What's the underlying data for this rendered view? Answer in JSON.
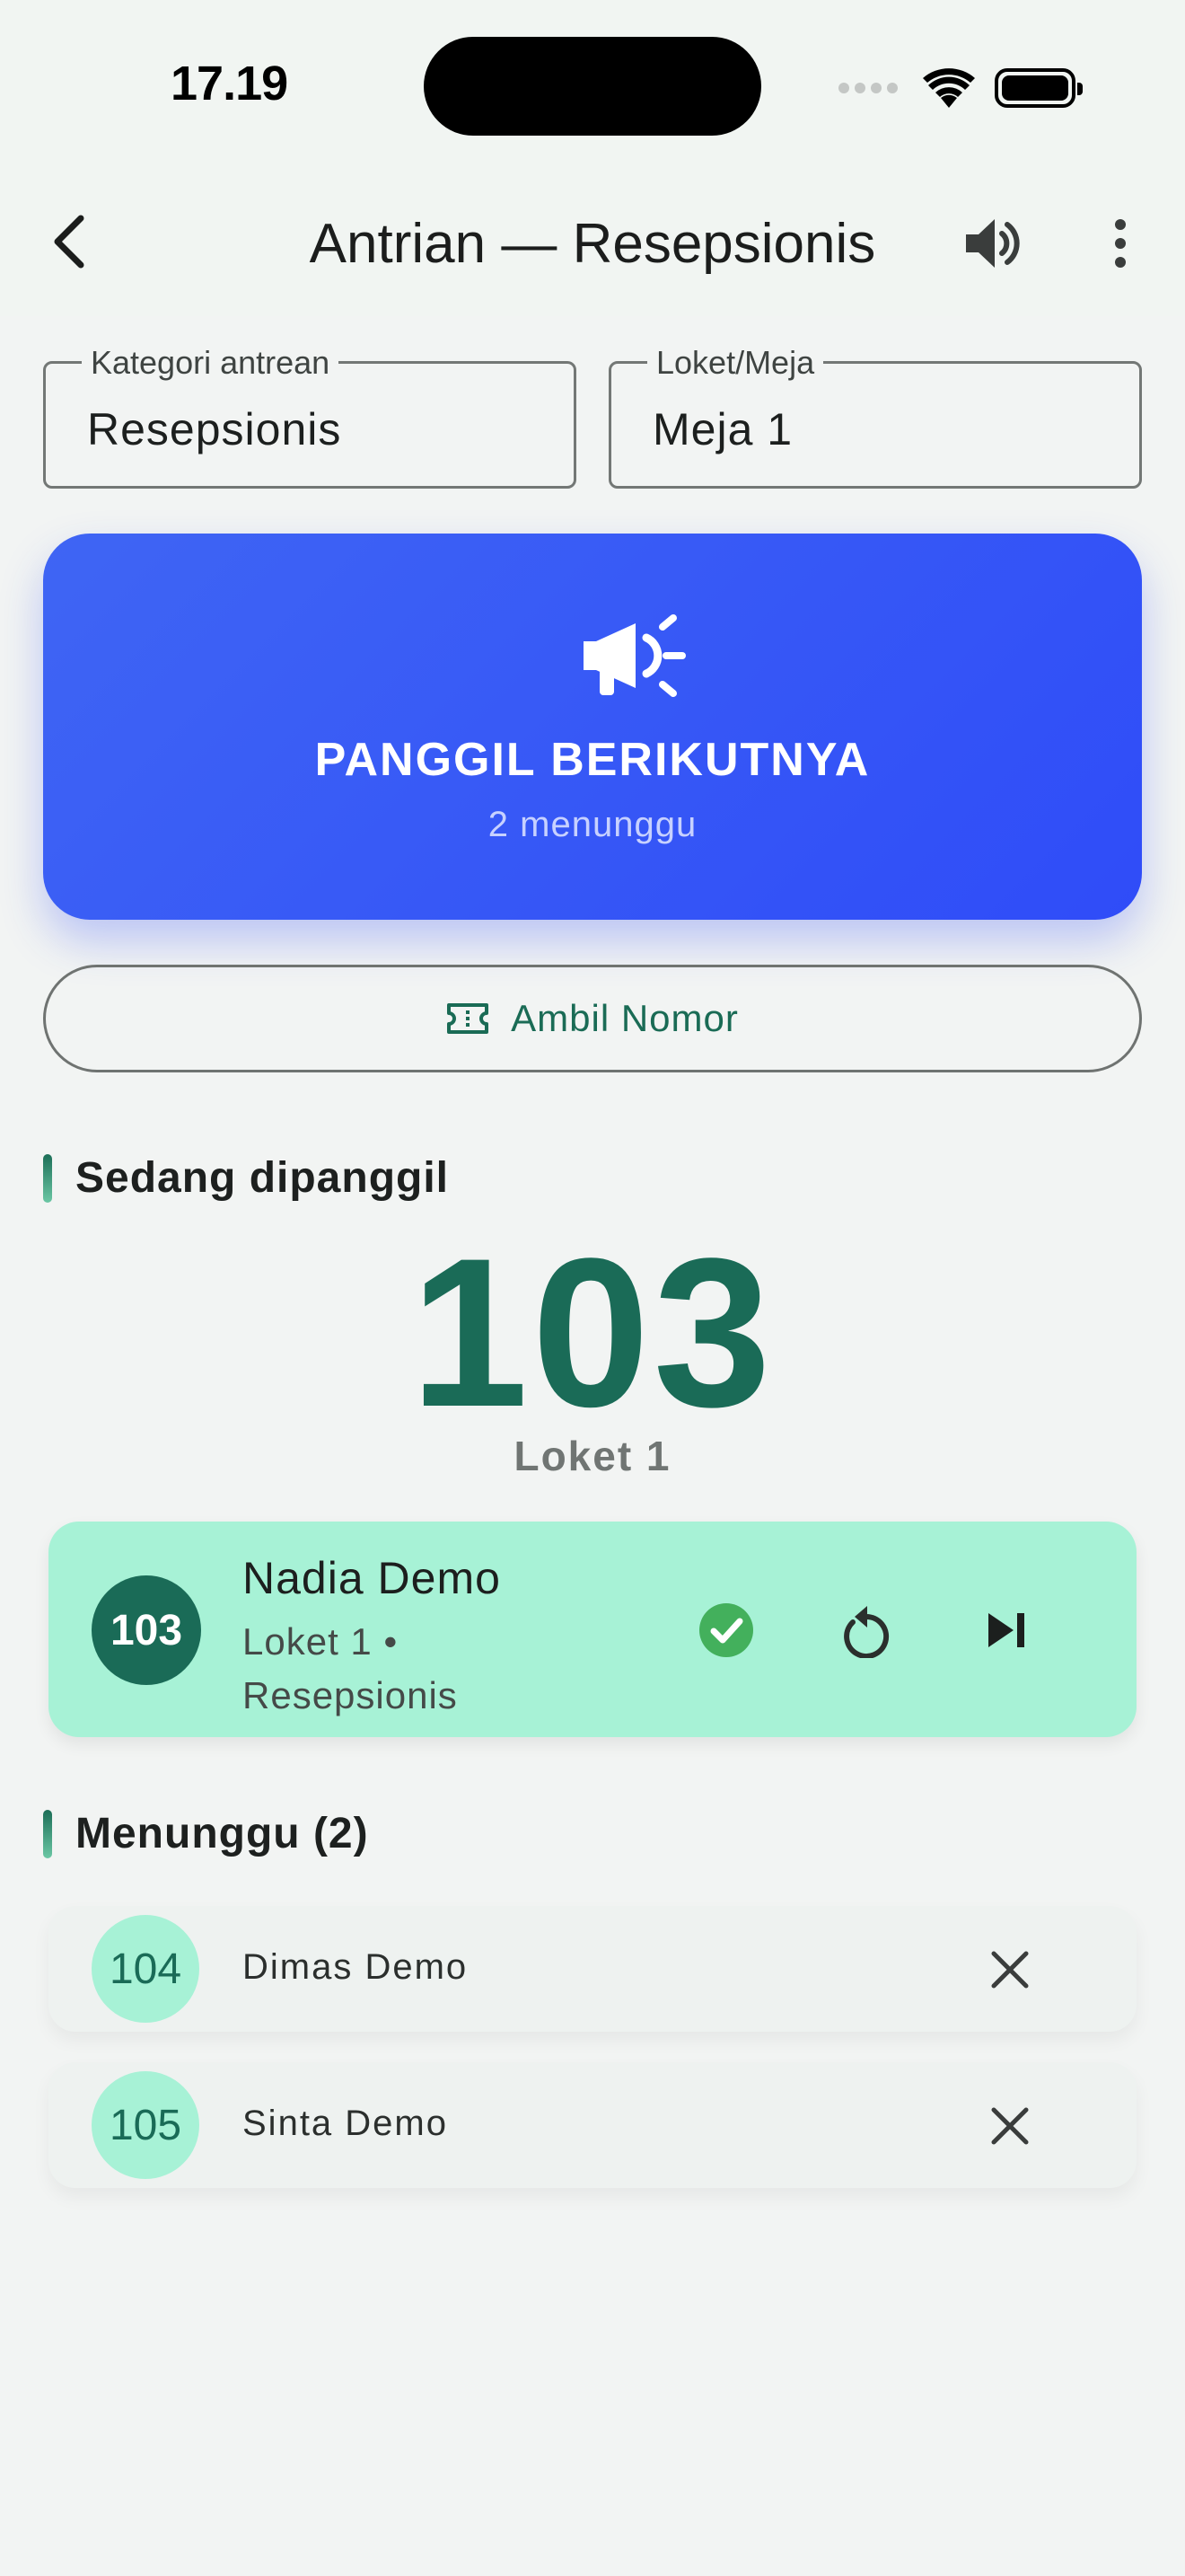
{
  "status_bar": {
    "time": "17.19"
  },
  "appbar": {
    "title": "Antrian — Resepsionis",
    "icons": [
      "back-arrow-icon",
      "volume-icon",
      "more-vert-icon"
    ]
  },
  "filters": {
    "category": {
      "label": "Kategori antrean",
      "value": "Resepsionis"
    },
    "counter": {
      "label": "Loket/Meja",
      "value": "Meja 1"
    }
  },
  "call_next": {
    "title": "PANGGIL BERIKUTNYA",
    "subtitle": "2 menunggu",
    "icon": "campaign-megaphone-icon",
    "color": "#3652f6"
  },
  "take_number": {
    "label": "Ambil Nomor",
    "icon": "ticket-icon"
  },
  "now_serving": {
    "heading": "Sedang dipanggil",
    "number": "103",
    "counter": "Loket 1",
    "card": {
      "badge": "103",
      "name": "Nadia Demo",
      "meta": "Loket 1 • Resepsionis",
      "actions": [
        "check-circle-icon",
        "replay-icon",
        "skip-next-icon"
      ]
    }
  },
  "waiting": {
    "heading": "Menunggu (2)",
    "items": [
      {
        "number": "104",
        "name": "Dimas Demo"
      },
      {
        "number": "105",
        "name": "Sinta Demo"
      }
    ]
  },
  "colors": {
    "primary_green": "#1a6b57",
    "mint": "#a7f2d6",
    "success": "#43b05c",
    "background": "#f2f4f3"
  }
}
